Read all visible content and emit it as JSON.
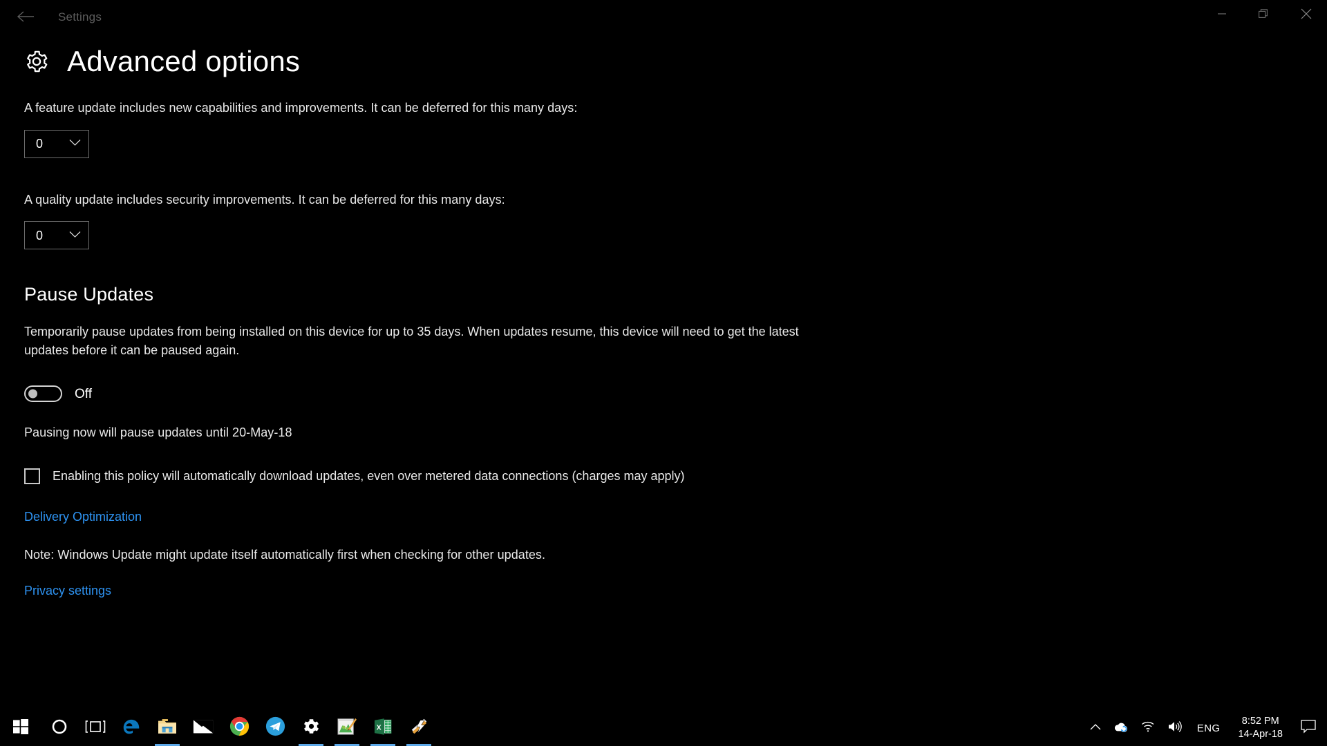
{
  "window": {
    "title": "Settings",
    "back_icon": "back-arrow-icon",
    "controls": {
      "minimize": "minimize-icon",
      "restore": "restore-icon",
      "close": "close-icon"
    }
  },
  "page": {
    "icon": "gear-icon",
    "title": "Advanced options",
    "feature_update": {
      "description": "A feature update includes new capabilities and improvements. It can be deferred for this many days:",
      "dropdown_value": "0",
      "dropdown_icon": "chevron-down-icon"
    },
    "quality_update": {
      "description": "A quality update includes security improvements. It can be deferred for this many days:",
      "dropdown_value": "0",
      "dropdown_icon": "chevron-down-icon"
    },
    "pause_updates": {
      "heading": "Pause Updates",
      "description": "Temporarily pause updates from being installed on this device for up to 35 days. When updates resume, this device will need to get the latest updates before it can be paused again.",
      "toggle_state": "Off",
      "pause_until_text": "Pausing now will pause updates until 20-May-18"
    },
    "metered_checkbox": {
      "label": "Enabling this policy will automatically download updates, even over metered data connections (charges may apply)",
      "checked": false
    },
    "delivery_optimization_link": "Delivery Optimization",
    "note": "Note: Windows Update might update itself automatically first when checking for other updates.",
    "privacy_link": "Privacy settings"
  },
  "colors": {
    "accent_link": "#2e93f2",
    "background": "#000000",
    "text": "#e9e9e9",
    "title_inactive": "#5d5d5d",
    "taskbar_indicator": "#5ca8e8"
  },
  "taskbar": {
    "items": [
      {
        "name": "start-button",
        "icon": "windows-logo-icon",
        "active": false
      },
      {
        "name": "cortana-button",
        "icon": "cortana-circle-icon",
        "active": false
      },
      {
        "name": "task-view-button",
        "icon": "task-view-icon",
        "active": false
      },
      {
        "name": "taskbar-edge",
        "icon": "edge-icon",
        "active": false
      },
      {
        "name": "taskbar-file-explorer",
        "icon": "file-explorer-icon",
        "active": true
      },
      {
        "name": "taskbar-mail",
        "icon": "mail-icon",
        "active": false
      },
      {
        "name": "taskbar-chrome",
        "icon": "chrome-icon",
        "active": false
      },
      {
        "name": "taskbar-telegram",
        "icon": "telegram-icon",
        "active": false
      },
      {
        "name": "taskbar-settings",
        "icon": "settings-gear-icon",
        "active": true
      },
      {
        "name": "taskbar-paint",
        "icon": "paint-icon",
        "active": true
      },
      {
        "name": "taskbar-excel",
        "icon": "excel-icon",
        "active": true
      },
      {
        "name": "taskbar-winamp",
        "icon": "winamp-icon",
        "active": true
      }
    ],
    "tray": {
      "show_hidden_icon": "chevron-up-icon",
      "onedrive_icon": "onedrive-sync-icon",
      "network_icon": "wifi-icon",
      "volume_icon": "speaker-icon",
      "language": "ENG",
      "time": "8:52 PM",
      "date": "14-Apr-18",
      "action_center_icon": "action-center-icon"
    }
  }
}
